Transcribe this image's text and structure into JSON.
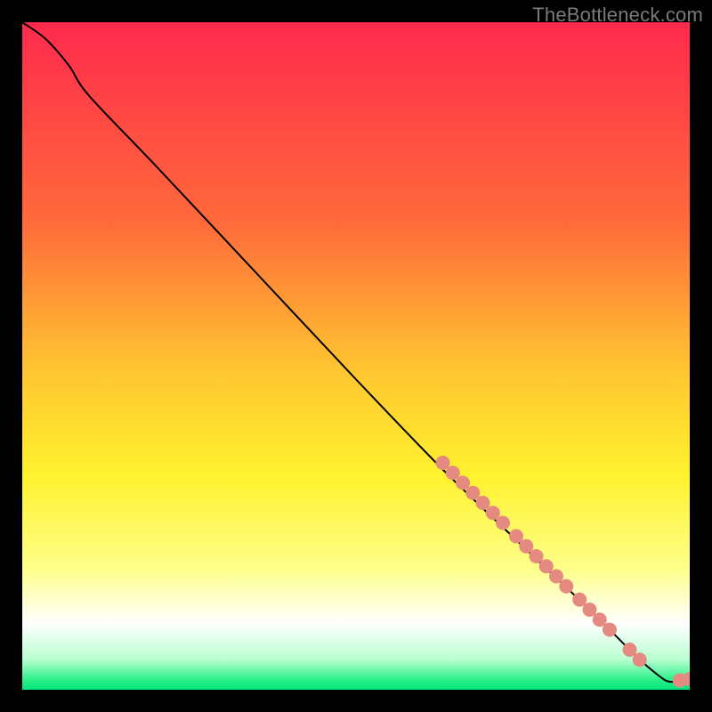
{
  "watermark": "TheBottleneck.com",
  "chart_data": {
    "type": "line",
    "xlabel": "",
    "ylabel": "",
    "title": "",
    "xlim": [
      0,
      100
    ],
    "ylim": [
      0,
      100
    ],
    "grid": false,
    "background_gradient": {
      "stops": [
        {
          "offset": 0.0,
          "color": "#ff2a4d"
        },
        {
          "offset": 0.3,
          "color": "#ff6a3a"
        },
        {
          "offset": 0.52,
          "color": "#ffc531"
        },
        {
          "offset": 0.68,
          "color": "#fff22e"
        },
        {
          "offset": 0.82,
          "color": "#fdff8a"
        },
        {
          "offset": 0.9,
          "color": "#ffffff"
        },
        {
          "offset": 0.955,
          "color": "#b8ffd0"
        },
        {
          "offset": 0.985,
          "color": "#2cf08a"
        },
        {
          "offset": 1.0,
          "color": "#00e37a"
        }
      ]
    },
    "series": [
      {
        "name": "curve",
        "type": "line",
        "color": "#000000",
        "points": [
          {
            "x": 0.0,
            "y": 100.0
          },
          {
            "x": 3.5,
            "y": 97.5
          },
          {
            "x": 7.0,
            "y": 93.5
          },
          {
            "x": 10.0,
            "y": 89.0
          },
          {
            "x": 20.0,
            "y": 78.5
          },
          {
            "x": 35.0,
            "y": 62.5
          },
          {
            "x": 50.0,
            "y": 46.5
          },
          {
            "x": 63.0,
            "y": 33.0
          },
          {
            "x": 75.0,
            "y": 21.5
          },
          {
            "x": 85.0,
            "y": 12.0
          },
          {
            "x": 92.0,
            "y": 5.0
          },
          {
            "x": 95.5,
            "y": 2.0
          },
          {
            "x": 97.0,
            "y": 1.2
          },
          {
            "x": 99.0,
            "y": 1.4
          },
          {
            "x": 100.0,
            "y": 1.6
          }
        ]
      },
      {
        "name": "highlight-dots",
        "type": "scatter",
        "color": "#e58a80",
        "radius": 8,
        "points": [
          {
            "x": 63.0,
            "y": 34.0
          },
          {
            "x": 64.5,
            "y": 32.5
          },
          {
            "x": 66.0,
            "y": 31.0
          },
          {
            "x": 67.5,
            "y": 29.5
          },
          {
            "x": 69.0,
            "y": 28.0
          },
          {
            "x": 70.5,
            "y": 26.5
          },
          {
            "x": 72.0,
            "y": 25.0
          },
          {
            "x": 74.0,
            "y": 23.0
          },
          {
            "x": 75.5,
            "y": 21.5
          },
          {
            "x": 77.0,
            "y": 20.0
          },
          {
            "x": 78.5,
            "y": 18.5
          },
          {
            "x": 80.0,
            "y": 17.0
          },
          {
            "x": 81.5,
            "y": 15.5
          },
          {
            "x": 83.5,
            "y": 13.5
          },
          {
            "x": 85.0,
            "y": 12.0
          },
          {
            "x": 86.5,
            "y": 10.5
          },
          {
            "x": 88.0,
            "y": 9.0
          },
          {
            "x": 91.0,
            "y": 6.0
          },
          {
            "x": 92.5,
            "y": 4.5
          },
          {
            "x": 98.5,
            "y": 1.4
          },
          {
            "x": 100.0,
            "y": 1.6
          }
        ]
      }
    ]
  }
}
